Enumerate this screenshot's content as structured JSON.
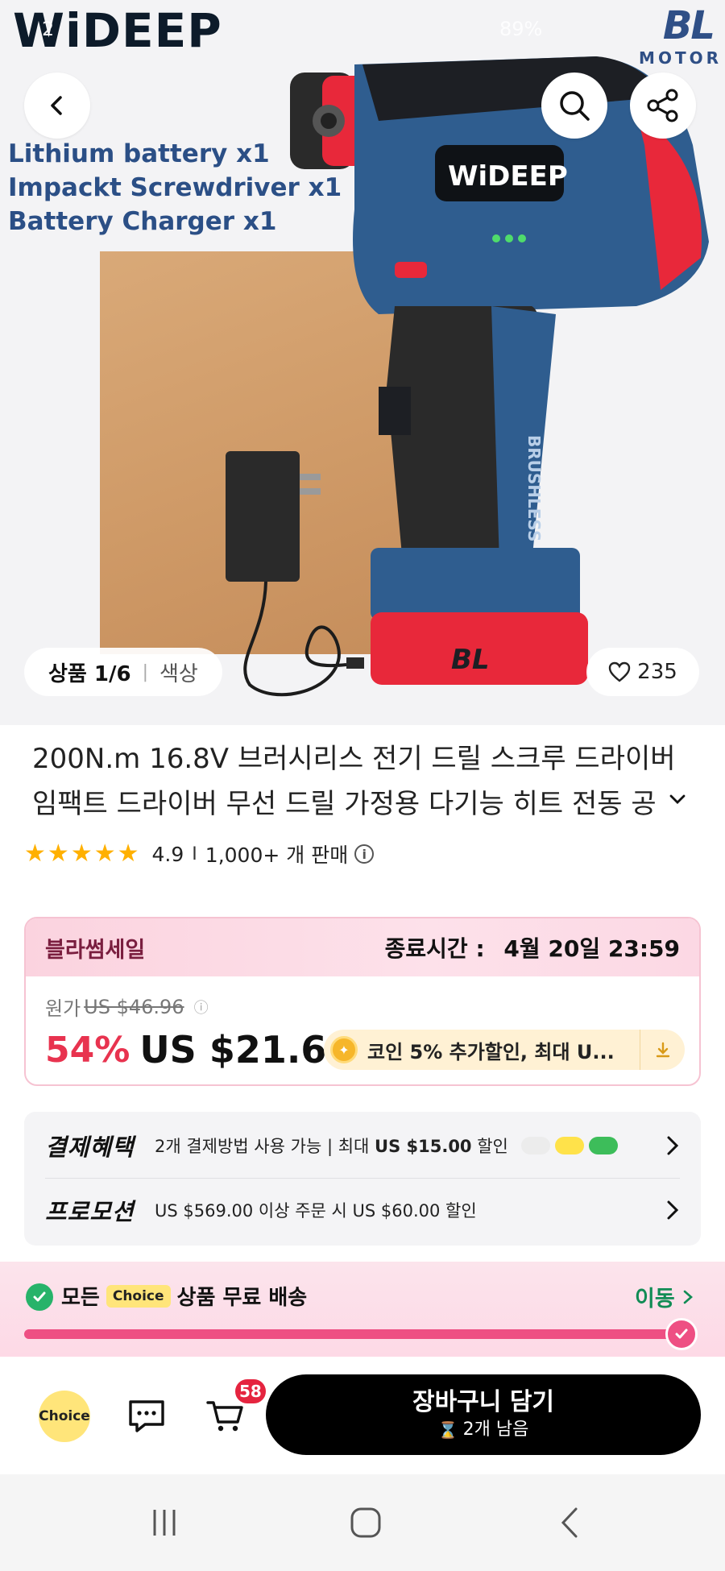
{
  "hero": {
    "brand_logo": "WiDEEP",
    "secondary_logo": {
      "bl": "BL",
      "motor": "MOTOR"
    },
    "status_time": "2",
    "status_right": "89%",
    "contents": [
      "Lithium battery x1",
      "Impackt Screwdriver x1",
      "Battery Charger x1"
    ],
    "drill_brand": "WiDEEP",
    "drill_side_text": "BRUSHLESS",
    "battery_text": "BL",
    "gallery_count": "상품 1/6",
    "gallery_color": "색상",
    "likes": "235"
  },
  "product": {
    "title_line1": "200N.m 16.8V 브러시리스 전기 드릴 스크루 드라이버",
    "title_line2": "임팩트 드라이버 무선 드릴 가정용 다기능 히트 전동 공",
    "rating": "4.9",
    "stars": 5,
    "sold": "1,000+ 개 판매"
  },
  "sale": {
    "name": "블라썸세일",
    "end_label": "종료시간 :",
    "end_date": "4월 20일 23:59",
    "original_label": "원가",
    "original_price": "US $46.96",
    "discount": "54%",
    "price": "US $21.60",
    "coin_text": "코인 5% 추가할인, 최대 U..."
  },
  "benefits": {
    "payment_label": "결제혜택",
    "payment_text_prefix": "2개 결제방법 사용 가능 | 최대 ",
    "payment_text_bold": "US $15.00",
    "payment_text_suffix": " 할인",
    "promotion_label": "프로모션",
    "promotion_text": "US $569.00 이상 주문 시 US $60.00 할인"
  },
  "shipping": {
    "prefix": "모든",
    "choice_tag": "Choice",
    "suffix": "상품 무료 배송",
    "move_label": "이동",
    "progress": 0.97
  },
  "bottom_bar": {
    "choice_label": "Choice",
    "cart_badge": "58",
    "add_to_cart": "장바구니 담기",
    "stock_left": "2개 남음"
  },
  "colors": {
    "sale_red": "#e8334f",
    "brand_pink": "#ee4f83",
    "choice_yellow": "#ffe57a",
    "ship_green": "#118c55",
    "cta_black": "#000000"
  }
}
